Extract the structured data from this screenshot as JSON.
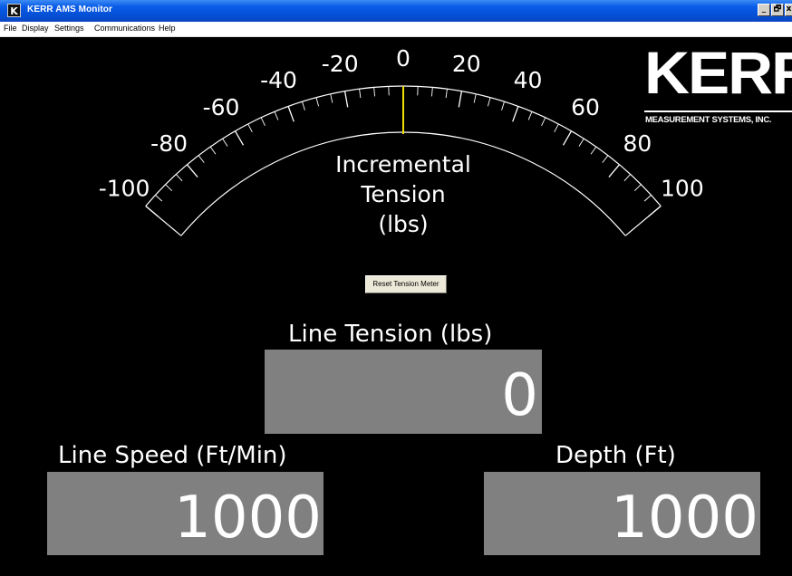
{
  "window": {
    "icon_glyph": "K",
    "title": "KERR AMS Monitor",
    "buttons": {
      "minimize": "_",
      "restore": "🗗",
      "close": "x"
    }
  },
  "menu": {
    "items": [
      "File",
      "Display",
      "Settings",
      "Communications",
      "Help"
    ]
  },
  "gauge": {
    "scale_labels": [
      "-100",
      "-80",
      "-60",
      "-40",
      "-20",
      "0",
      "20",
      "40",
      "60",
      "80",
      "100"
    ],
    "min": -100,
    "max": 100,
    "needle_value": 0,
    "needle_color": "#f0e000",
    "label_lines": [
      "Incremental",
      "Tension",
      "(lbs)"
    ]
  },
  "logo": {
    "word": "KERR",
    "subtitle": "MEASUREMENT SYSTEMS, INC."
  },
  "reset_button": {
    "label": "Reset Tension Meter"
  },
  "line_tension": {
    "label": "Line Tension (lbs)",
    "value": "0"
  },
  "line_speed": {
    "label": "Line Speed (Ft/Min)",
    "value": "1000"
  },
  "depth": {
    "label": "Depth (Ft)",
    "value": "1000"
  },
  "colors": {
    "background": "#000000",
    "readout_box": "#808080",
    "titlebar": "#0a5ce8"
  }
}
